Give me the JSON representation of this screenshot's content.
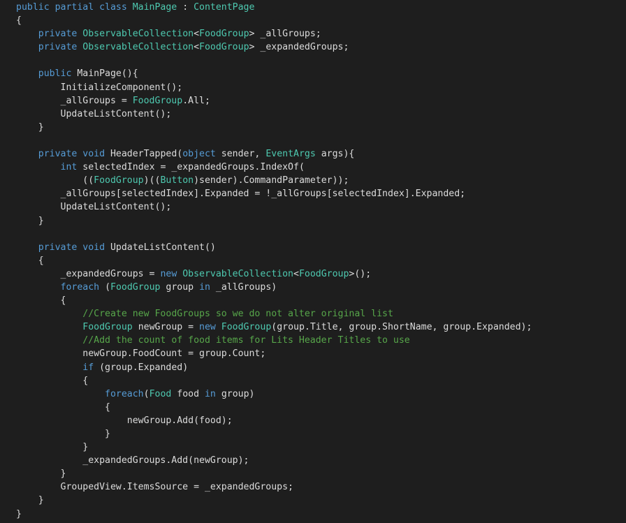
{
  "editor": {
    "language": "csharp",
    "theme": {
      "background": "#1e1e1e",
      "default_text": "#dcdcdc",
      "keyword": "#569cd6",
      "type": "#4ec9b0",
      "comment": "#57a64a"
    },
    "lines": [
      [
        [
          "kw",
          "public partial class "
        ],
        [
          "ty",
          "MainPage"
        ],
        [
          "pl",
          " : "
        ],
        [
          "ty",
          "ContentPage"
        ]
      ],
      [
        [
          "pl",
          "{"
        ]
      ],
      [
        [
          "pl",
          "    "
        ],
        [
          "kw",
          "private "
        ],
        [
          "ty",
          "ObservableCollection"
        ],
        [
          "pl",
          "<"
        ],
        [
          "ty",
          "FoodGroup"
        ],
        [
          "pl",
          "> _allGroups;"
        ]
      ],
      [
        [
          "pl",
          "    "
        ],
        [
          "kw",
          "private "
        ],
        [
          "ty",
          "ObservableCollection"
        ],
        [
          "pl",
          "<"
        ],
        [
          "ty",
          "FoodGroup"
        ],
        [
          "pl",
          "> _expandedGroups;"
        ]
      ],
      [
        [
          "pl",
          ""
        ]
      ],
      [
        [
          "pl",
          "    "
        ],
        [
          "kw",
          "public "
        ],
        [
          "pl",
          "MainPage(){"
        ]
      ],
      [
        [
          "pl",
          "        InitializeComponent();"
        ]
      ],
      [
        [
          "pl",
          "        _allGroups = "
        ],
        [
          "ty",
          "FoodGroup"
        ],
        [
          "pl",
          ".All;"
        ]
      ],
      [
        [
          "pl",
          "        UpdateListContent();"
        ]
      ],
      [
        [
          "pl",
          "    }"
        ]
      ],
      [
        [
          "pl",
          ""
        ]
      ],
      [
        [
          "pl",
          "    "
        ],
        [
          "kw",
          "private void "
        ],
        [
          "pl",
          "HeaderTapped("
        ],
        [
          "kw",
          "object "
        ],
        [
          "pl",
          "sender, "
        ],
        [
          "ty",
          "EventArgs "
        ],
        [
          "pl",
          "args){"
        ]
      ],
      [
        [
          "pl",
          "        "
        ],
        [
          "kw",
          "int "
        ],
        [
          "pl",
          "selectedIndex = _expandedGroups.IndexOf("
        ]
      ],
      [
        [
          "pl",
          "            (("
        ],
        [
          "ty",
          "FoodGroup"
        ],
        [
          "pl",
          ")(("
        ],
        [
          "ty",
          "Button"
        ],
        [
          "pl",
          ")sender).CommandParameter));"
        ]
      ],
      [
        [
          "pl",
          "        _allGroups[selectedIndex].Expanded = !_allGroups[selectedIndex].Expanded;"
        ]
      ],
      [
        [
          "pl",
          "        UpdateListContent();"
        ]
      ],
      [
        [
          "pl",
          "    }"
        ]
      ],
      [
        [
          "pl",
          ""
        ]
      ],
      [
        [
          "pl",
          "    "
        ],
        [
          "kw",
          "private void "
        ],
        [
          "pl",
          "UpdateListContent()"
        ]
      ],
      [
        [
          "pl",
          "    {"
        ]
      ],
      [
        [
          "pl",
          "        _expandedGroups = "
        ],
        [
          "kw",
          "new "
        ],
        [
          "ty",
          "ObservableCollection"
        ],
        [
          "pl",
          "<"
        ],
        [
          "ty",
          "FoodGroup"
        ],
        [
          "pl",
          ">();"
        ]
      ],
      [
        [
          "pl",
          "        "
        ],
        [
          "kw",
          "foreach "
        ],
        [
          "pl",
          "("
        ],
        [
          "ty",
          "FoodGroup "
        ],
        [
          "pl",
          "group "
        ],
        [
          "kw",
          "in "
        ],
        [
          "pl",
          "_allGroups)"
        ]
      ],
      [
        [
          "pl",
          "        {"
        ]
      ],
      [
        [
          "pl",
          "            "
        ],
        [
          "cm",
          "//Create new FoodGroups so we do not alter original list"
        ]
      ],
      [
        [
          "pl",
          "            "
        ],
        [
          "ty",
          "FoodGroup "
        ],
        [
          "pl",
          "newGroup = "
        ],
        [
          "kw",
          "new "
        ],
        [
          "ty",
          "FoodGroup"
        ],
        [
          "pl",
          "(group.Title, group.ShortName, group.Expanded);"
        ]
      ],
      [
        [
          "pl",
          "            "
        ],
        [
          "cm",
          "//Add the count of food items for Lits Header Titles to use"
        ]
      ],
      [
        [
          "pl",
          "            newGroup.FoodCount = group.Count;"
        ]
      ],
      [
        [
          "pl",
          "            "
        ],
        [
          "kw",
          "if "
        ],
        [
          "pl",
          "(group.Expanded)"
        ]
      ],
      [
        [
          "pl",
          "            {"
        ]
      ],
      [
        [
          "pl",
          "                "
        ],
        [
          "kw",
          "foreach"
        ],
        [
          "pl",
          "("
        ],
        [
          "ty",
          "Food "
        ],
        [
          "pl",
          "food "
        ],
        [
          "kw",
          "in "
        ],
        [
          "pl",
          "group)"
        ]
      ],
      [
        [
          "pl",
          "                {"
        ]
      ],
      [
        [
          "pl",
          "                    newGroup.Add(food);"
        ]
      ],
      [
        [
          "pl",
          "                }"
        ]
      ],
      [
        [
          "pl",
          "            }"
        ]
      ],
      [
        [
          "pl",
          "            _expandedGroups.Add(newGroup);"
        ]
      ],
      [
        [
          "pl",
          "        }"
        ]
      ],
      [
        [
          "pl",
          "        GroupedView.ItemsSource = _expandedGroups;"
        ]
      ],
      [
        [
          "pl",
          "    }"
        ]
      ],
      [
        [
          "pl",
          "}"
        ]
      ]
    ]
  }
}
